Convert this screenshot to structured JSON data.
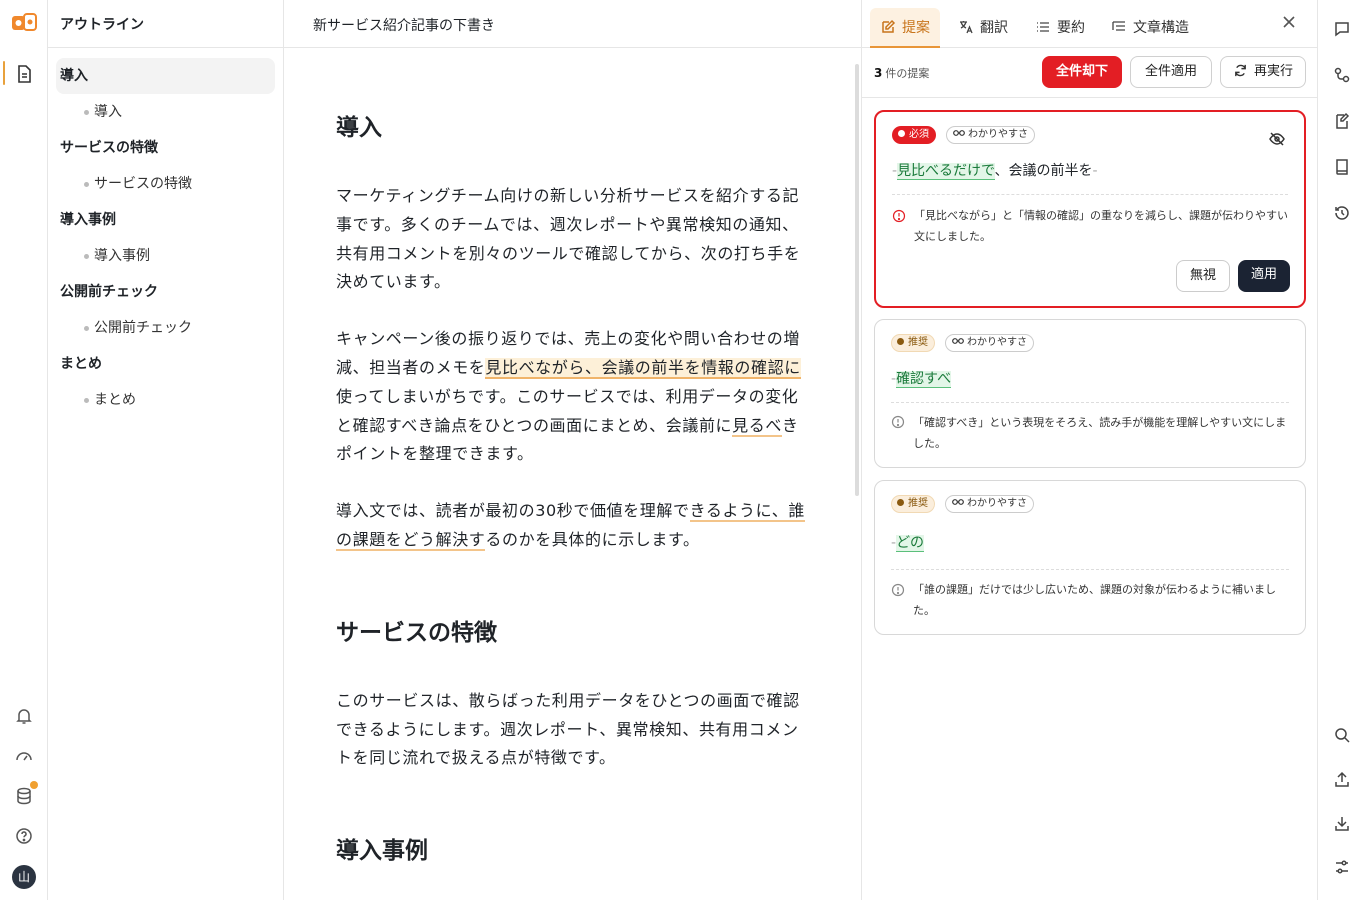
{
  "outline": {
    "title": "アウトライン",
    "sections": [
      {
        "heading": "導入",
        "sub": "導入"
      },
      {
        "heading": "サービスの特徴",
        "sub": "サービスの特徴"
      },
      {
        "heading": "導入事例",
        "sub": "導入事例"
      },
      {
        "heading": "公開前チェック",
        "sub": "公開前チェック"
      },
      {
        "heading": "まとめ",
        "sub": "まとめ"
      }
    ]
  },
  "rail": {
    "avatar": "山"
  },
  "editor": {
    "doc_title": "新サービス紹介記事の下書き",
    "h1": "導入",
    "p1": "マーケティングチーム向けの新しい分析サービスを紹介する記事です。多くのチームでは、週次レポートや異常検知の通知、共有用コメントを別々のツールで確認してから、次の打ち手を決めています。",
    "p2a": "キャンペーン後の振り返りでは、売上の変化や問い合わせの増減、担当者のメモを",
    "p2hl": "見比べながら、会議の前半を情報の確認に",
    "p2b": "使ってしまいがちです。このサービスでは、利用データの変化と確認すべき論点をひとつの画面にまとめ、会議前に",
    "p2hl2": "見るべ",
    "p2c": "きポイントを整理できます。",
    "p3a": "導入文では、読者が最初の30秒で価値を理解で",
    "p3hl": "きるように、誰の課題をどう解決す",
    "p3b": "るのかを具体的に示します。",
    "h2": "サービスの特徴",
    "p4": "このサービスは、散らばった利用データをひとつの画面で確認できるようにします。週次レポート、異常検知、共有用コメントを同じ流れで扱える点が特徴です。",
    "h3": "導入事例"
  },
  "panel": {
    "tabs": [
      "提案",
      "翻訳",
      "要約",
      "文章構造"
    ],
    "count_num": "3",
    "count_label": "件の提案",
    "reject_all": "全件却下",
    "apply_all": "全件適用",
    "rerun": "再実行",
    "cards": [
      {
        "level": "必須",
        "category": "わかりやすさ",
        "insert": "見比べるだけで",
        "rest": "、会議の前半を",
        "note": "「見比べながら」と「情報の確認」の重なりを減らし、課題が伝わりやすい文にしました。",
        "ignore": "無視",
        "apply": "適用"
      },
      {
        "level": "推奨",
        "category": "わかりやすさ",
        "insert": "確認すべ",
        "note": "「確認すべき」という表現をそろえ、読み手が機能を理解しやすい文にしました。"
      },
      {
        "level": "推奨",
        "category": "わかりやすさ",
        "insert": "どの",
        "note": "「誰の課題」だけでは少し広いため、課題の対象が伝わるように補いました。"
      }
    ]
  },
  "colors": {
    "accent": "#e89538",
    "danger": "#e31e24",
    "insert_bg": "#e3f6e8"
  }
}
